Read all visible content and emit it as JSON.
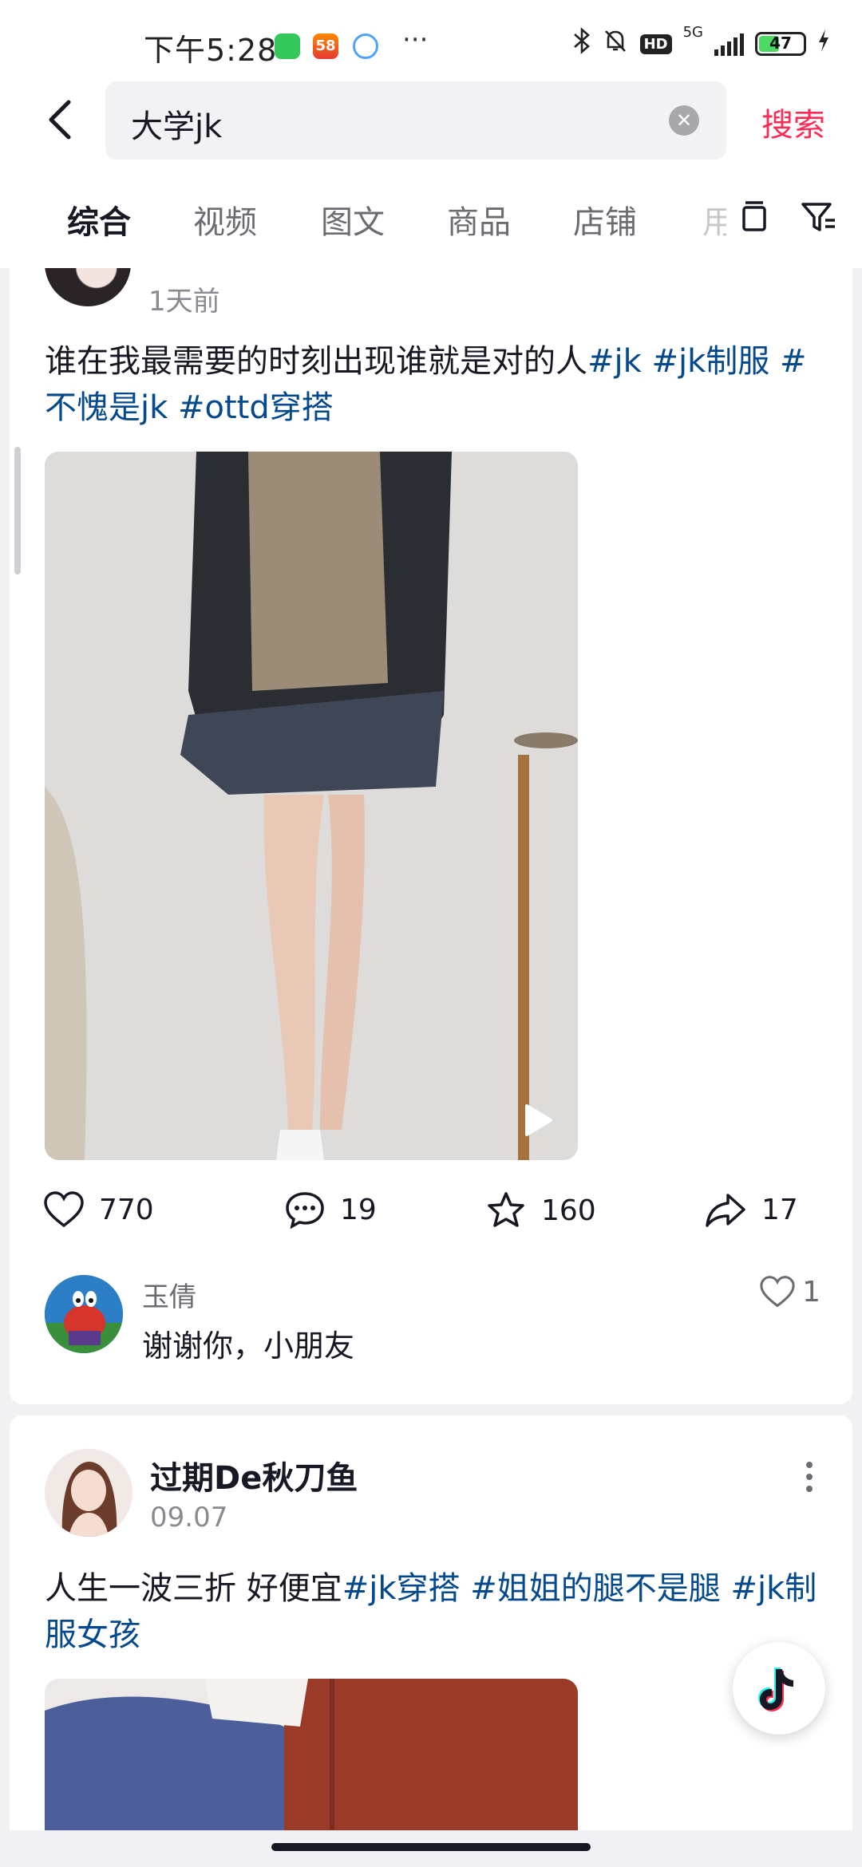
{
  "status_bar": {
    "time": "下午5:28",
    "app_badge": "58",
    "network": "5G",
    "hd": "HD",
    "battery": "47",
    "battery_level": 0.47
  },
  "search": {
    "query": "大学jk",
    "submit_label": "搜索"
  },
  "tabs": {
    "items": [
      "综合",
      "视频",
      "图文",
      "商品",
      "店铺",
      "用"
    ],
    "active": "综合"
  },
  "posts": [
    {
      "time": "1天前",
      "text": "谁在我最需要的时刻出现谁就是对的人",
      "tags": [
        "#jk",
        "#jk制服",
        "#不愧是jk",
        "#ottd穿搭"
      ],
      "stats": {
        "likes": "770",
        "comments": "19",
        "favorites": "160",
        "shares": "17"
      },
      "top_comment": {
        "author": "玉倩",
        "text": "谢谢你，小朋友",
        "likes": "1"
      }
    },
    {
      "author": "过期De秋刀鱼",
      "time": "09.07",
      "text": "人生一波三折 好便宜",
      "tags": [
        "#jk穿搭",
        "#姐姐的腿不是腿",
        "#jk制服女孩"
      ]
    }
  ],
  "colors": {
    "accent": "#fe2c55",
    "tag": "#04498d",
    "text": "#161823",
    "secondary": "#8a8b91"
  }
}
